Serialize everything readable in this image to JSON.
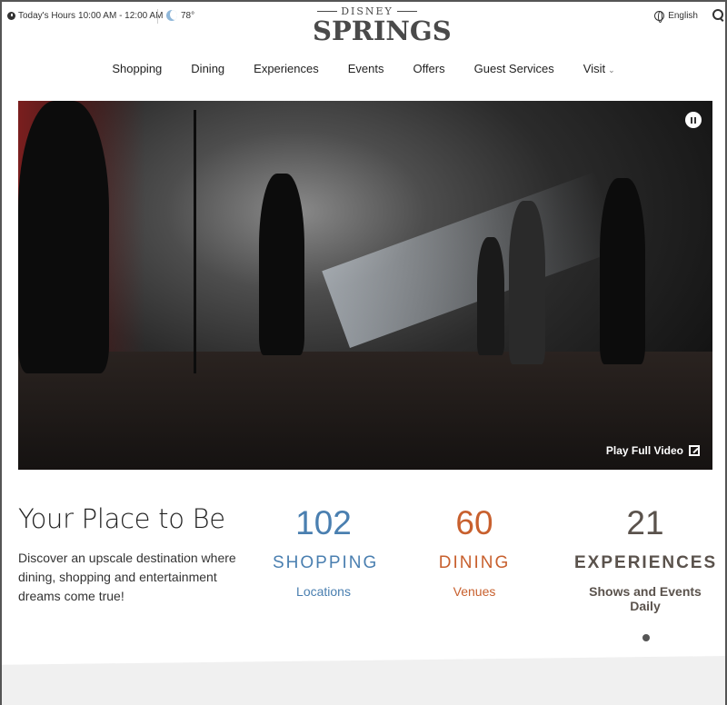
{
  "topbar": {
    "hours_label": "Today's Hours",
    "hours_value": "10:00 AM - 12:00 AM",
    "temperature": "78°",
    "language": "English"
  },
  "logo": {
    "top": "DISNEY",
    "main": "SPRINGS"
  },
  "nav": {
    "items": [
      "Shopping",
      "Dining",
      "Experiences",
      "Events",
      "Offers",
      "Guest Services",
      "Visit"
    ]
  },
  "hero": {
    "play_full_label": "Play Full Video"
  },
  "intro": {
    "title": "Your Place to Be",
    "text": "Discover an upscale destination where dining, shopping and entertainment dreams come true!"
  },
  "stats": [
    {
      "number": "102",
      "category": "SHOPPING",
      "sub": "Locations",
      "color": "#4a7fb0"
    },
    {
      "number": "60",
      "category": "DINING",
      "sub": "Venues",
      "color": "#c8602e"
    },
    {
      "number": "21",
      "category": "EXPERIENCES",
      "sub": "Shows and Events Daily",
      "color": "#5a524c"
    }
  ]
}
